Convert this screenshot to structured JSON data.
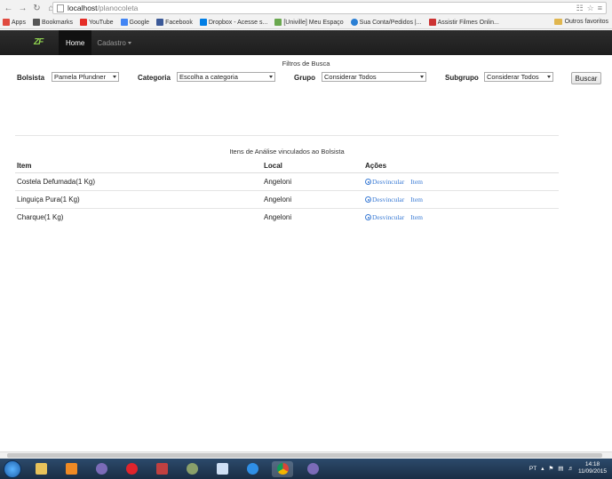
{
  "browser": {
    "url_host": "localhost",
    "url_path": "/planocoleta",
    "bookmarks": [
      {
        "label": "Apps",
        "color": "#e04a3f"
      },
      {
        "label": "Bookmarks",
        "color": "#555555"
      },
      {
        "label": "YouTube",
        "color": "#e52d27"
      },
      {
        "label": "Google",
        "color": "#4285f4"
      },
      {
        "label": "Facebook",
        "color": "#3b5998"
      },
      {
        "label": "Dropbox - Acesse s...",
        "color": "#007ee5"
      },
      {
        "label": "[Univille] Meu Espaço",
        "color": "#6aa84f"
      },
      {
        "label": "Sua Conta/Pedidos |...",
        "color": "#2a7fd4"
      },
      {
        "label": "Assistir Filmes Onlin...",
        "color": "#cc3333"
      }
    ],
    "other_bookmarks": "Outros favoritos"
  },
  "navbar": {
    "brand": "ZF",
    "home": "Home",
    "cadastro": "Cadastro"
  },
  "filters": {
    "title": "Filtros de Busca",
    "bolsista_label": "Bolsista",
    "bolsista_value": "Pamela Pfundner",
    "categoria_label": "Categoria",
    "categoria_value": "Escolha a categoria",
    "grupo_label": "Grupo",
    "grupo_value": "Considerar Todos",
    "subgrupo_label": "Subgrupo",
    "subgrupo_value": "Considerar Todos",
    "search_button": "Buscar"
  },
  "items": {
    "title": "Itens de Análise vinculados ao Bolsista",
    "columns": [
      "Item",
      "Local",
      "Ações"
    ],
    "rows": [
      {
        "item": "Costela Defumada(1 Kg)",
        "local": "Angeloni",
        "action1": "Desvincular",
        "action2": "Item"
      },
      {
        "item": "Linguiça Pura(1 Kg)",
        "local": "Angeloni",
        "action1": "Desvincular",
        "action2": "Item"
      },
      {
        "item": "Charque(1 Kg)",
        "local": "Angeloni",
        "action1": "Desvincular",
        "action2": "Item"
      }
    ]
  },
  "taskbar": {
    "lang": "PT",
    "time": "14:18",
    "date": "11/09/2015"
  }
}
